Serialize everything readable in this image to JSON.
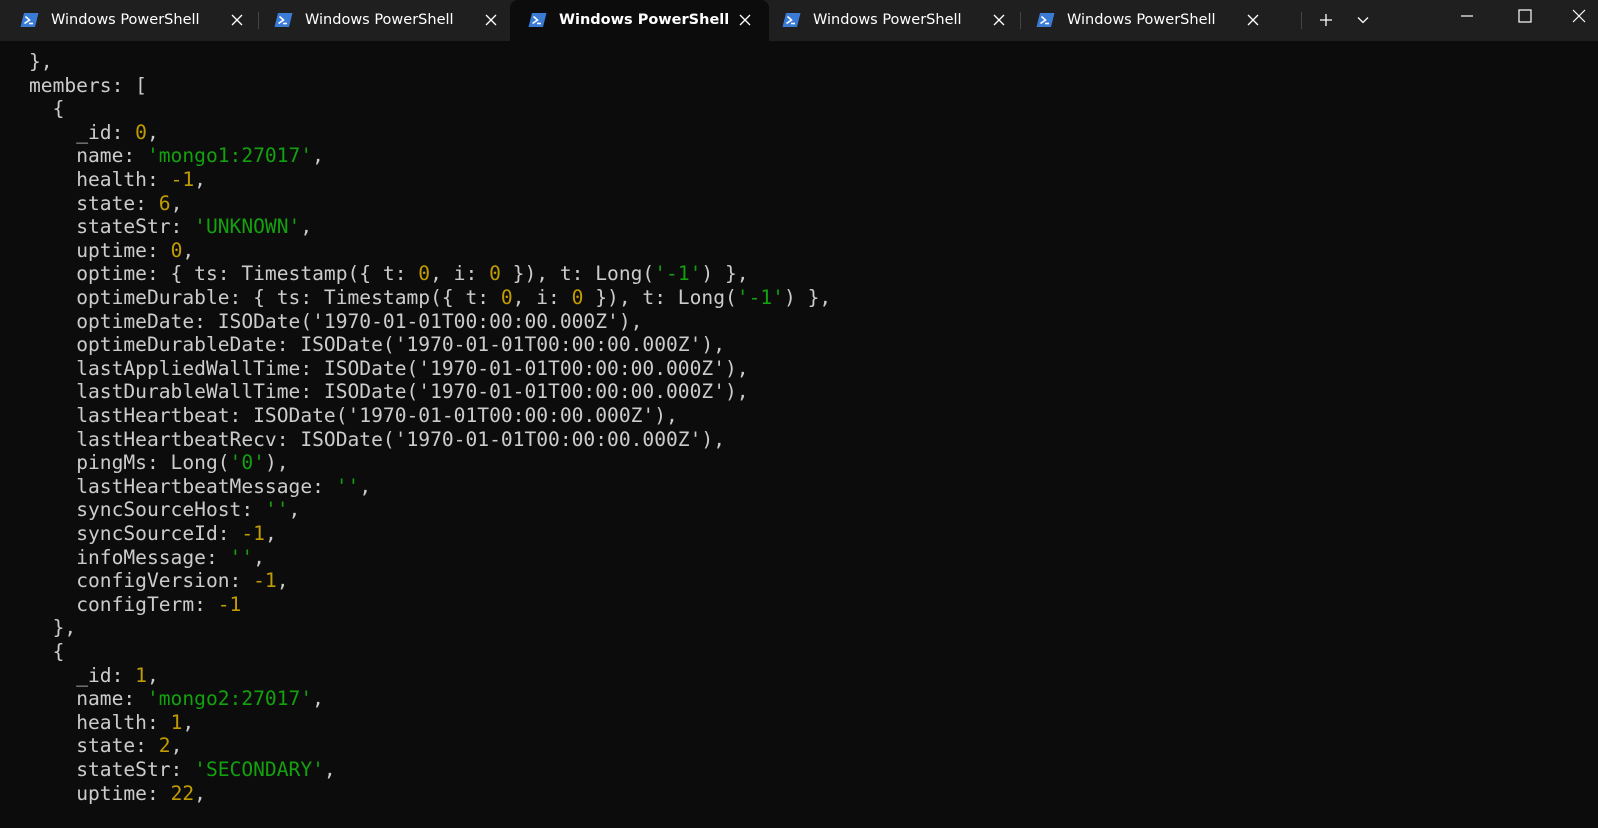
{
  "window": {
    "tabs": [
      {
        "title": "Windows PowerShell",
        "active": false
      },
      {
        "title": "Windows PowerShell",
        "active": false
      },
      {
        "title": "Windows PowerShell",
        "active": true
      },
      {
        "title": "Windows PowerShell",
        "active": false
      },
      {
        "title": "Windows PowerShell",
        "active": false
      }
    ],
    "new_tab_icon": "plus-icon",
    "dropdown_icon": "chevron-down-icon",
    "controls": [
      "minimize-icon",
      "maximize-icon",
      "close-icon"
    ]
  },
  "colors": {
    "background": "#0c0c0c",
    "titlebar": "#1f1f1f",
    "text": "#cccccc",
    "number": "#c19c00",
    "string": "#13a10e",
    "tab_icon": "#3a7bd5"
  },
  "terminal": {
    "lines": [
      {
        "indent": 0,
        "segments": [
          {
            "t": "},",
            "c": "plain"
          }
        ]
      },
      {
        "indent": 0,
        "segments": [
          {
            "t": "members: [",
            "c": "plain"
          }
        ]
      },
      {
        "indent": 2,
        "segments": [
          {
            "t": "{",
            "c": "plain"
          }
        ]
      },
      {
        "indent": 4,
        "segments": [
          {
            "t": "_id: ",
            "c": "plain"
          },
          {
            "t": "0",
            "c": "num"
          },
          {
            "t": ",",
            "c": "plain"
          }
        ]
      },
      {
        "indent": 4,
        "segments": [
          {
            "t": "name: ",
            "c": "plain"
          },
          {
            "t": "'mongo1:27017'",
            "c": "str"
          },
          {
            "t": ",",
            "c": "plain"
          }
        ]
      },
      {
        "indent": 4,
        "segments": [
          {
            "t": "health: ",
            "c": "plain"
          },
          {
            "t": "-1",
            "c": "num"
          },
          {
            "t": ",",
            "c": "plain"
          }
        ]
      },
      {
        "indent": 4,
        "segments": [
          {
            "t": "state: ",
            "c": "plain"
          },
          {
            "t": "6",
            "c": "num"
          },
          {
            "t": ",",
            "c": "plain"
          }
        ]
      },
      {
        "indent": 4,
        "segments": [
          {
            "t": "stateStr: ",
            "c": "plain"
          },
          {
            "t": "'UNKNOWN'",
            "c": "str"
          },
          {
            "t": ",",
            "c": "plain"
          }
        ]
      },
      {
        "indent": 4,
        "segments": [
          {
            "t": "uptime: ",
            "c": "plain"
          },
          {
            "t": "0",
            "c": "num"
          },
          {
            "t": ",",
            "c": "plain"
          }
        ]
      },
      {
        "indent": 4,
        "segments": [
          {
            "t": "optime: { ts: Timestamp({ t: ",
            "c": "plain"
          },
          {
            "t": "0",
            "c": "num"
          },
          {
            "t": ", i: ",
            "c": "plain"
          },
          {
            "t": "0",
            "c": "num"
          },
          {
            "t": " }), t: Long(",
            "c": "plain"
          },
          {
            "t": "'-1'",
            "c": "str"
          },
          {
            "t": ") },",
            "c": "plain"
          }
        ]
      },
      {
        "indent": 4,
        "segments": [
          {
            "t": "optimeDurable: { ts: Timestamp({ t: ",
            "c": "plain"
          },
          {
            "t": "0",
            "c": "num"
          },
          {
            "t": ", i: ",
            "c": "plain"
          },
          {
            "t": "0",
            "c": "num"
          },
          {
            "t": " }), t: Long(",
            "c": "plain"
          },
          {
            "t": "'-1'",
            "c": "str"
          },
          {
            "t": ") },",
            "c": "plain"
          }
        ]
      },
      {
        "indent": 4,
        "segments": [
          {
            "t": "optimeDate: ISODate('1970-01-01T00:00:00.000Z'),",
            "c": "plain"
          }
        ]
      },
      {
        "indent": 4,
        "segments": [
          {
            "t": "optimeDurableDate: ISODate('1970-01-01T00:00:00.000Z'),",
            "c": "plain"
          }
        ]
      },
      {
        "indent": 4,
        "segments": [
          {
            "t": "lastAppliedWallTime: ISODate('1970-01-01T00:00:00.000Z'),",
            "c": "plain"
          }
        ]
      },
      {
        "indent": 4,
        "segments": [
          {
            "t": "lastDurableWallTime: ISODate('1970-01-01T00:00:00.000Z'),",
            "c": "plain"
          }
        ]
      },
      {
        "indent": 4,
        "segments": [
          {
            "t": "lastHeartbeat: ISODate('1970-01-01T00:00:00.000Z'),",
            "c": "plain"
          }
        ]
      },
      {
        "indent": 4,
        "segments": [
          {
            "t": "lastHeartbeatRecv: ISODate('1970-01-01T00:00:00.000Z'),",
            "c": "plain"
          }
        ]
      },
      {
        "indent": 4,
        "segments": [
          {
            "t": "pingMs: Long(",
            "c": "plain"
          },
          {
            "t": "'0'",
            "c": "str"
          },
          {
            "t": "),",
            "c": "plain"
          }
        ]
      },
      {
        "indent": 4,
        "segments": [
          {
            "t": "lastHeartbeatMessage: ",
            "c": "plain"
          },
          {
            "t": "''",
            "c": "str"
          },
          {
            "t": ",",
            "c": "plain"
          }
        ]
      },
      {
        "indent": 4,
        "segments": [
          {
            "t": "syncSourceHost: ",
            "c": "plain"
          },
          {
            "t": "''",
            "c": "str"
          },
          {
            "t": ",",
            "c": "plain"
          }
        ]
      },
      {
        "indent": 4,
        "segments": [
          {
            "t": "syncSourceId: ",
            "c": "plain"
          },
          {
            "t": "-1",
            "c": "num"
          },
          {
            "t": ",",
            "c": "plain"
          }
        ]
      },
      {
        "indent": 4,
        "segments": [
          {
            "t": "infoMessage: ",
            "c": "plain"
          },
          {
            "t": "''",
            "c": "str"
          },
          {
            "t": ",",
            "c": "plain"
          }
        ]
      },
      {
        "indent": 4,
        "segments": [
          {
            "t": "configVersion: ",
            "c": "plain"
          },
          {
            "t": "-1",
            "c": "num"
          },
          {
            "t": ",",
            "c": "plain"
          }
        ]
      },
      {
        "indent": 4,
        "segments": [
          {
            "t": "configTerm: ",
            "c": "plain"
          },
          {
            "t": "-1",
            "c": "num"
          }
        ]
      },
      {
        "indent": 2,
        "segments": [
          {
            "t": "},",
            "c": "plain"
          }
        ]
      },
      {
        "indent": 2,
        "segments": [
          {
            "t": "{",
            "c": "plain"
          }
        ]
      },
      {
        "indent": 4,
        "segments": [
          {
            "t": "_id: ",
            "c": "plain"
          },
          {
            "t": "1",
            "c": "num"
          },
          {
            "t": ",",
            "c": "plain"
          }
        ]
      },
      {
        "indent": 4,
        "segments": [
          {
            "t": "name: ",
            "c": "plain"
          },
          {
            "t": "'mongo2:27017'",
            "c": "str"
          },
          {
            "t": ",",
            "c": "plain"
          }
        ]
      },
      {
        "indent": 4,
        "segments": [
          {
            "t": "health: ",
            "c": "plain"
          },
          {
            "t": "1",
            "c": "num"
          },
          {
            "t": ",",
            "c": "plain"
          }
        ]
      },
      {
        "indent": 4,
        "segments": [
          {
            "t": "state: ",
            "c": "plain"
          },
          {
            "t": "2",
            "c": "num"
          },
          {
            "t": ",",
            "c": "plain"
          }
        ]
      },
      {
        "indent": 4,
        "segments": [
          {
            "t": "stateStr: ",
            "c": "plain"
          },
          {
            "t": "'SECONDARY'",
            "c": "str"
          },
          {
            "t": ",",
            "c": "plain"
          }
        ]
      },
      {
        "indent": 4,
        "segments": [
          {
            "t": "uptime: ",
            "c": "plain"
          },
          {
            "t": "22",
            "c": "num"
          },
          {
            "t": ",",
            "c": "plain"
          }
        ]
      }
    ]
  }
}
